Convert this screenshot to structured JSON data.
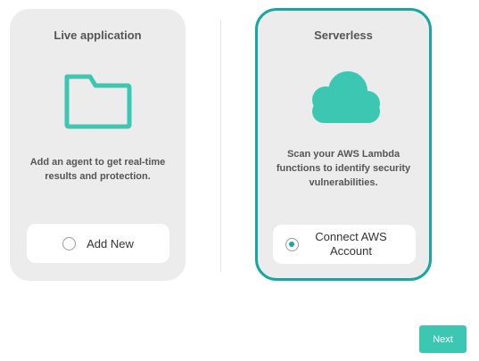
{
  "colors": {
    "accent": "#17a7a3",
    "icon_teal": "#3cc7b3",
    "card_bg": "#ececec",
    "next_button": "#3cc7b3"
  },
  "cards": [
    {
      "title": "Live application",
      "icon": "folder-icon",
      "description": "Add an agent to get real-time results and protection.",
      "option_label": "Add New",
      "selected": false
    },
    {
      "title": "Serverless",
      "icon": "cloud-icon",
      "description": "Scan your AWS Lambda functions to identify security vulnerabilities.",
      "option_label": "Connect AWS\nAccount",
      "selected": true
    }
  ],
  "footer": {
    "next_label": "Next"
  }
}
